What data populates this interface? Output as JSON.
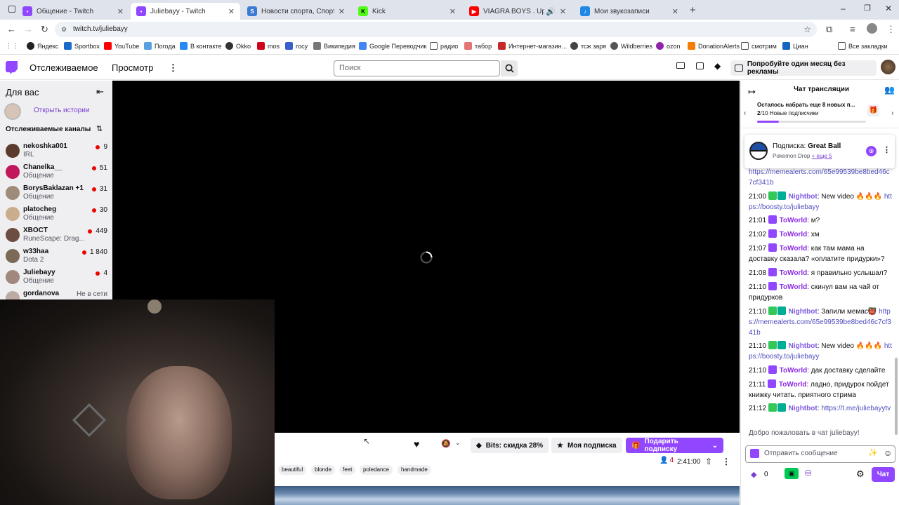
{
  "browser": {
    "tabs": [
      {
        "title": "Общение - Twitch",
        "color": "#9146ff"
      },
      {
        "title": "Juliebayy - Twitch",
        "color": "#9146ff"
      },
      {
        "title": "Новости спорта, Спортивная",
        "color": "#3b7bd6"
      },
      {
        "title": "Kick",
        "color": "#53fc18"
      },
      {
        "title": "VIAGRA BOYS . Upside Bac",
        "color": "#ff0000"
      },
      {
        "title": "Мои звукозаписи",
        "color": "#1e88e5"
      }
    ],
    "url": "twitch.tv/juliebayy",
    "bookmarks": [
      "Яндекс",
      "Sportbox",
      "YouTube",
      "Погода",
      "В контакте",
      "Okko",
      "mos",
      "госу",
      "Википедия",
      "Google Переводчик",
      "радио",
      "табор",
      "Интернет-магазин...",
      "тсж заря",
      "Wildberries",
      "ozon",
      "DonationAlerts",
      "смотрим",
      "Циан"
    ],
    "all_bookmarks": "Все закладки"
  },
  "nav": {
    "following": "Отслеживаемое",
    "browse": "Просмотр",
    "search_placeholder": "Поиск",
    "promo": "Попробуйте один месяц без рекламы"
  },
  "sidebar": {
    "for_you": "Для вас",
    "open_stories": "Открыть истории",
    "followed_header": "Отслеживаемые каналы",
    "channels": [
      {
        "name": "nekoshka001",
        "game": "IRL",
        "viewers": "9"
      },
      {
        "name": "Chanelka__",
        "game": "Общение",
        "viewers": "51"
      },
      {
        "name": "BorysBaklazan +1",
        "game": "Общение",
        "viewers": "31"
      },
      {
        "name": "platocheg",
        "game": "Общение",
        "viewers": "30"
      },
      {
        "name": "XBOCT",
        "game": "RuneScape: Drag...",
        "viewers": "449"
      },
      {
        "name": "w33haa",
        "game": "Dota 2",
        "viewers": "1 840"
      },
      {
        "name": "Juliebayy",
        "game": "Общение",
        "viewers": "4"
      },
      {
        "name": "gordanova",
        "game": "",
        "viewers": "Не в сети"
      }
    ]
  },
  "player": {
    "bits_label": "Bits: скидка 28%",
    "my_sub_label": "Моя подписка",
    "gift_sub_label": "Подарить подписку",
    "viewer_count": "4",
    "uptime": "2:41:00",
    "tags": [
      "beautiful",
      "blonde",
      "feet",
      "poledance",
      "handmade"
    ]
  },
  "chat": {
    "header": "Чат трансляции",
    "goal_title": "Осталось набрать еще 8 новых п...",
    "goal_sub_count": "2",
    "goal_sub_rest": "/10 Новые подписчики",
    "goal_progress": 0.2,
    "drop_label": "Подписка:",
    "drop_item": "Great Ball",
    "drop_source": "Pokemon Drop",
    "drop_more": "+ еще 5",
    "messages": [
      {
        "link": "https://memealerts.com/65e99539be8bed46c7cf341b"
      },
      {
        "time": "21:00",
        "user": "Nightbot",
        "text": " New video 🔥🔥🔥",
        "link": "https://boosty.to/juliebayy"
      },
      {
        "time": "21:01",
        "user": "ToWorld",
        "text": " м?"
      },
      {
        "time": "21:02",
        "user": "ToWorld",
        "text": " хм"
      },
      {
        "time": "21:07",
        "user": "ToWorld",
        "text": " как там мама на доставку сказала? «оплатите придурки»?"
      },
      {
        "time": "21:08",
        "user": "ToWorld",
        "text": " я правильно услышал?"
      },
      {
        "time": "21:10",
        "user": "ToWorld",
        "text": " скинул вам на чай от придурков"
      },
      {
        "time": "21:10",
        "user": "Nightbot",
        "text": " Запили мемас👹",
        "link": "https://memealerts.com/65e99539be8bed46c7cf341b"
      },
      {
        "time": "21:10",
        "user": "Nightbot",
        "text": " New video 🔥🔥🔥",
        "link": "https://boosty.to/juliebayy"
      },
      {
        "time": "21:10",
        "user": "ToWorld",
        "text": " дак доставку сделайте"
      },
      {
        "time": "21:11",
        "user": "ToWorld",
        "text": " ладно, придурок пойдет книжку читать. приятного стрима"
      },
      {
        "time": "21:12",
        "user": "Nightbot",
        "text": "",
        "link": "https://t.me/juliebayytv"
      }
    ],
    "welcome": "Добро пожаловать в чат juliebayy!",
    "input_placeholder": "Отправить сообщение",
    "points": "0",
    "send_label": "Чат"
  }
}
